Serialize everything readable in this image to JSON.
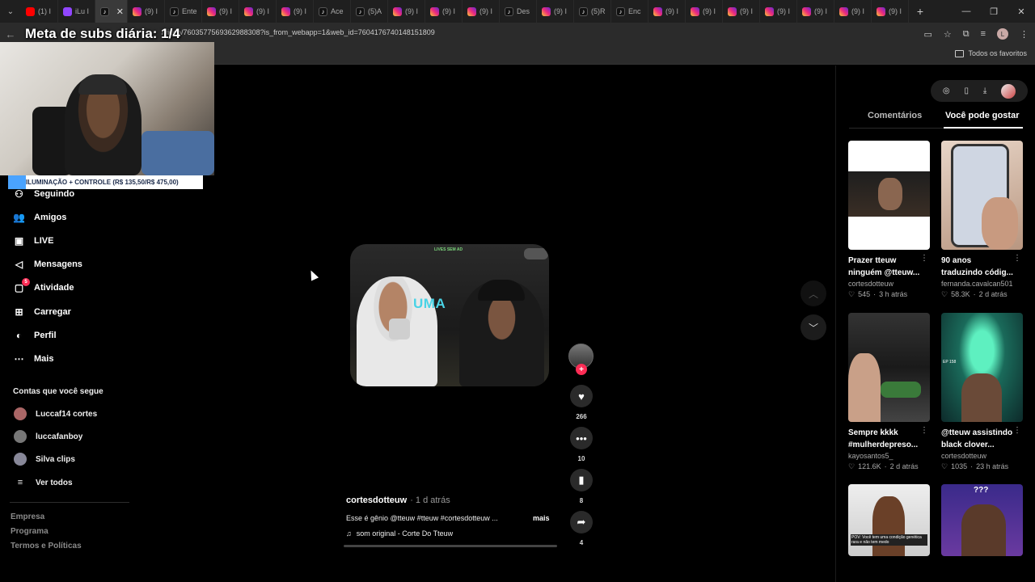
{
  "browser": {
    "tabs": [
      {
        "icon": "youtube-icon",
        "label": "(1) I"
      },
      {
        "icon": "twitch-icon",
        "label": "iLu I"
      },
      {
        "icon": "tiktok-icon",
        "label": "",
        "active": true
      },
      {
        "icon": "instagram-icon",
        "label": "(9) I"
      },
      {
        "icon": "tiktok-icon",
        "label": "Ente"
      },
      {
        "icon": "instagram-icon",
        "label": "(9) I"
      },
      {
        "icon": "instagram-icon",
        "label": "(9) I"
      },
      {
        "icon": "instagram-icon",
        "label": "(9) I"
      },
      {
        "icon": "tiktok-icon",
        "label": "Ace"
      },
      {
        "icon": "tiktok-icon",
        "label": "(5)A"
      },
      {
        "icon": "instagram-icon",
        "label": "(9) I"
      },
      {
        "icon": "instagram-icon",
        "label": "(9) I"
      },
      {
        "icon": "instagram-icon",
        "label": "(9) I"
      },
      {
        "icon": "tiktok-icon",
        "label": "Des"
      },
      {
        "icon": "instagram-icon",
        "label": "(9) I"
      },
      {
        "icon": "tiktok-icon",
        "label": "(5)R"
      },
      {
        "icon": "tiktok-icon",
        "label": "Enc"
      },
      {
        "icon": "instagram-icon",
        "label": "(9) I"
      },
      {
        "icon": "instagram-icon",
        "label": "(9) I"
      },
      {
        "icon": "instagram-icon",
        "label": "(9) I"
      },
      {
        "icon": "instagram-icon",
        "label": "(9) I"
      },
      {
        "icon": "instagram-icon",
        "label": "(9) I"
      },
      {
        "icon": "instagram-icon",
        "label": "(9) I"
      },
      {
        "icon": "instagram-icon",
        "label": "(9) I"
      }
    ],
    "active_tab_close": "✕",
    "new_tab": "+",
    "url": "/video/7603577569362988308?is_from_webapp=1&web_id=7604176740148151809",
    "profile_initial": "L",
    "bookmarks_all": "Todos os favoritos"
  },
  "overlay": {
    "title": "Meta de subs diária: 1/4",
    "banner": "ILUMINAÇÃO + CONTROLE (R$ 135,50/R$ 475,00)"
  },
  "sidebar": {
    "items": [
      {
        "label": "Seguindo",
        "icon": "following-icon"
      },
      {
        "label": "Amigos",
        "icon": "friends-icon"
      },
      {
        "label": "LIVE",
        "icon": "live-icon"
      },
      {
        "label": "Mensagens",
        "icon": "messages-icon"
      },
      {
        "label": "Atividade",
        "icon": "activity-icon",
        "badge": "5"
      },
      {
        "label": "Carregar",
        "icon": "upload-icon"
      },
      {
        "label": "Perfil",
        "icon": "profile-icon"
      },
      {
        "label": "Mais",
        "icon": "more-icon"
      }
    ],
    "following_header": "Contas que você segue",
    "following": [
      {
        "name": "Luccaf14 cortes"
      },
      {
        "name": "luccafanboy"
      },
      {
        "name": "Silva clips"
      }
    ],
    "see_all": "Ver todos",
    "footer": [
      "Empresa",
      "Programa",
      "Termos e Políticas"
    ]
  },
  "video": {
    "overlay_text": "UMA",
    "top_text": "LIVES SEM AD",
    "author": "cortesdotteuw",
    "time": "· 1 d atrás",
    "description": "Esse é gênio @tteuw #tteuw #cortesdotteuw ...",
    "more": "mais",
    "music": "som original - Corte Do Tteuw",
    "likes": "266",
    "comments": "10",
    "saves": "8",
    "shares": "4"
  },
  "right_panel": {
    "tabs": [
      "Comentários",
      "Você pode gostar"
    ],
    "active_tab": "Você pode gostar",
    "cards": [
      {
        "title": "Prazer tteuw\nninguém @tteuw...",
        "user": "cortesdotteuw",
        "likes": "545",
        "age": "3 h atrás"
      },
      {
        "title": "90 anos\ntraduzindo códig...",
        "user": "fernanda.cavalcan501",
        "likes": "58.3K",
        "age": "2 d atrás"
      },
      {
        "title": "Sempre kkkk\n#mulherdepreso...",
        "user": "kayosantos5_",
        "likes": "121.6K",
        "age": "2 d atrás"
      },
      {
        "title": "@tteuw assistindo\nblack clover...",
        "user": "cortesdotteuw",
        "likes": "1035",
        "age": "23 h atrás"
      },
      {
        "title": "",
        "user": "",
        "likes": "",
        "age": ""
      },
      {
        "title": "",
        "user": "",
        "likes": "",
        "age": ""
      }
    ],
    "card3_caption": "EP 158",
    "card6_caption": "???",
    "card5_caption": "POV: Você tem uma condição genética rara e não tem medo"
  },
  "colors": {
    "accent": "#fe2c55",
    "banner_blue": "#4aa3ff",
    "video_text": "#49d3e6"
  }
}
